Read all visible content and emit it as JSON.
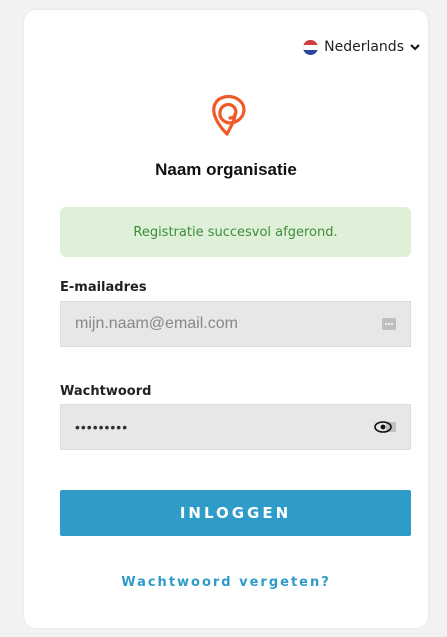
{
  "language": {
    "label": "Nederlands",
    "flag_icon": "nl-flag-icon",
    "chevron_icon": "chevron-down-icon"
  },
  "org": {
    "name": "Naam organisatie",
    "logo_icon": "org-logo-icon"
  },
  "alert": {
    "message": "Registratie succesvol afgerond."
  },
  "email": {
    "label": "E-mailadres",
    "value": "mijn.naam@email.com",
    "action_icon": "more-dots-icon"
  },
  "password": {
    "label": "Wachtwoord",
    "value": "•••••••••",
    "action_icon": "eye-icon"
  },
  "login": {
    "label": "INLOGGEN"
  },
  "forgot": {
    "label": "Wachtwoord vergeten?"
  },
  "colors": {
    "primary": "#2f9bc9",
    "success_bg": "#dff0d8",
    "success_text": "#3c8d3c",
    "logo": "#f05a28"
  }
}
